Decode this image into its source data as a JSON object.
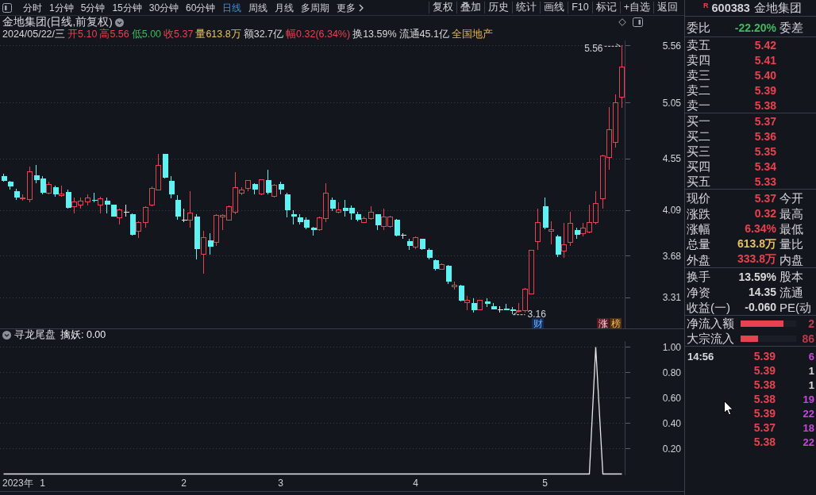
{
  "toolbar": {
    "periods": [
      {
        "label": "分时",
        "selected": false
      },
      {
        "label": "1分钟",
        "selected": false
      },
      {
        "label": "5分钟",
        "selected": false
      },
      {
        "label": "15分钟",
        "selected": false
      },
      {
        "label": "30分钟",
        "selected": false
      },
      {
        "label": "60分钟",
        "selected": false
      },
      {
        "label": "日线",
        "selected": true
      },
      {
        "label": "周线",
        "selected": false
      },
      {
        "label": "月线",
        "selected": false
      },
      {
        "label": "多周期",
        "selected": false
      }
    ],
    "more": "更多",
    "actions": [
      "复权",
      "叠加",
      "历史",
      "统计",
      "画线",
      "F10",
      "标记",
      "+自选",
      "返回"
    ]
  },
  "chart_header": {
    "title": "金地集团(日线,前复权)"
  },
  "quote_line": {
    "date": "2024/05/22/三",
    "items": [
      {
        "text": "开5.10",
        "color": "#e8414f"
      },
      {
        "text": "高5.56",
        "color": "#e8414f"
      },
      {
        "text": "低5.00",
        "color": "#3cb95c"
      },
      {
        "text": "收5.37",
        "color": "#e8414f"
      },
      {
        "text": "量613.8万",
        "color": "#e8c060"
      },
      {
        "text": "额32.7亿",
        "color": "#d8d8d8"
      },
      {
        "text": "幅0.32(6.34%)",
        "color": "#e8414f"
      },
      {
        "text": "换13.59%",
        "color": "#d8d8d8"
      },
      {
        "text": "流通45.1亿",
        "color": "#d8d8d8"
      },
      {
        "text": "全国地产",
        "color": "#e8b84a"
      }
    ]
  },
  "main_chart": {
    "chart_data": [
      {
        "type": "candlestick",
        "ohlc": [
          [
            4.39,
            4.41,
            4.34,
            4.35
          ],
          [
            4.34,
            4.35,
            4.27,
            4.3
          ],
          [
            4.26,
            4.28,
            4.18,
            4.2
          ],
          [
            4.19,
            4.23,
            4.17,
            4.2
          ],
          [
            4.18,
            4.48,
            4.16,
            4.43
          ],
          [
            4.4,
            4.49,
            4.33,
            4.36
          ],
          [
            4.37,
            4.39,
            4.23,
            4.24
          ],
          [
            4.24,
            4.34,
            4.23,
            4.32
          ],
          [
            4.29,
            4.31,
            4.21,
            4.23
          ],
          [
            4.22,
            4.31,
            4.21,
            4.23
          ],
          [
            4.25,
            4.27,
            4.1,
            4.11
          ],
          [
            4.12,
            4.2,
            4.06,
            4.16
          ],
          [
            4.13,
            4.2,
            4.1,
            4.17
          ],
          [
            4.16,
            4.23,
            4.13,
            4.2
          ],
          [
            4.18,
            4.24,
            4.16,
            4.17
          ],
          [
            4.13,
            4.21,
            4.06,
            4.19
          ],
          [
            4.17,
            4.2,
            4.06,
            4.14
          ],
          [
            4.14,
            4.14,
            4.03,
            4.03
          ],
          [
            4.02,
            4.1,
            3.96,
            4.09
          ],
          [
            4.07,
            4.14,
            4.03,
            4.07
          ],
          [
            4.05,
            4.06,
            3.86,
            3.87
          ],
          [
            3.9,
            3.99,
            3.84,
            3.98
          ],
          [
            3.98,
            4.12,
            3.93,
            4.11
          ],
          [
            4.13,
            4.3,
            4.12,
            4.28
          ],
          [
            4.27,
            4.59,
            4.27,
            4.49
          ],
          [
            4.59,
            4.59,
            4.37,
            4.38
          ],
          [
            4.35,
            4.39,
            4.19,
            4.23
          ],
          [
            4.18,
            4.22,
            4.0,
            4.03
          ],
          [
            4.0,
            4.1,
            3.98,
            4.0
          ],
          [
            4.0,
            4.26,
            3.93,
            4.06
          ],
          [
            4.03,
            4.05,
            3.65,
            3.74
          ],
          [
            3.69,
            3.9,
            3.52,
            3.84
          ],
          [
            3.82,
            3.88,
            3.69,
            3.76
          ],
          [
            3.8,
            4.05,
            3.77,
            4.04
          ],
          [
            4.03,
            4.05,
            3.91,
            4.04
          ],
          [
            4.0,
            4.13,
            4.0,
            4.12
          ],
          [
            4.07,
            4.43,
            4.05,
            4.29
          ],
          [
            4.24,
            4.29,
            4.22,
            4.27
          ],
          [
            4.28,
            4.36,
            4.26,
            4.35
          ],
          [
            4.32,
            4.33,
            4.23,
            4.27
          ],
          [
            4.23,
            4.36,
            4.22,
            4.36
          ],
          [
            4.36,
            4.45,
            4.23,
            4.24
          ],
          [
            4.21,
            4.32,
            4.2,
            4.31
          ],
          [
            4.32,
            4.34,
            4.23,
            4.27
          ],
          [
            4.23,
            4.24,
            4.02,
            4.09
          ],
          [
            4.05,
            4.09,
            3.96,
            4.03
          ],
          [
            4.02,
            4.05,
            3.96,
            3.98
          ],
          [
            4.0,
            4.02,
            3.92,
            3.93
          ],
          [
            3.93,
            3.94,
            3.86,
            3.91
          ],
          [
            3.91,
            4.03,
            3.9,
            4.02
          ],
          [
            4.01,
            4.33,
            3.98,
            4.24
          ],
          [
            4.18,
            4.2,
            4.08,
            4.1
          ],
          [
            4.07,
            4.16,
            4.06,
            4.09
          ],
          [
            4.11,
            4.18,
            4.03,
            4.08
          ],
          [
            4.11,
            4.13,
            4.0,
            4.06
          ],
          [
            4.05,
            4.07,
            3.99,
            4.0
          ],
          [
            3.98,
            4.03,
            3.97,
            4.01
          ],
          [
            4.01,
            4.12,
            4.0,
            4.07
          ],
          [
            4.05,
            4.05,
            3.91,
            3.95
          ],
          [
            3.94,
            4.1,
            3.91,
            4.03
          ],
          [
            3.94,
            4.04,
            3.93,
            4.03
          ],
          [
            4.0,
            4.01,
            3.85,
            3.86
          ],
          [
            3.86,
            3.88,
            3.83,
            3.86
          ],
          [
            3.81,
            3.83,
            3.73,
            3.77
          ],
          [
            3.76,
            3.85,
            3.74,
            3.84
          ],
          [
            3.83,
            3.83,
            3.73,
            3.74
          ],
          [
            3.73,
            3.75,
            3.65,
            3.66
          ],
          [
            3.64,
            3.65,
            3.55,
            3.56
          ],
          [
            3.56,
            3.61,
            3.56,
            3.6
          ],
          [
            3.59,
            3.6,
            3.43,
            3.45
          ],
          [
            3.4,
            3.45,
            3.38,
            3.42
          ],
          [
            3.41,
            3.42,
            3.27,
            3.28
          ],
          [
            3.26,
            3.32,
            3.19,
            3.28
          ],
          [
            3.26,
            3.3,
            3.17,
            3.19
          ],
          [
            3.2,
            3.28,
            3.2,
            3.28
          ],
          [
            3.27,
            3.3,
            3.22,
            3.25
          ],
          [
            3.23,
            3.26,
            3.2,
            3.2
          ],
          [
            3.2,
            3.23,
            3.17,
            3.2
          ],
          [
            3.21,
            3.25,
            3.19,
            3.19
          ],
          [
            3.2,
            3.22,
            3.16,
            3.19
          ],
          [
            3.18,
            3.26,
            3.17,
            3.19
          ],
          [
            3.19,
            3.39,
            3.17,
            3.38
          ],
          [
            3.34,
            3.73,
            3.34,
            3.73
          ],
          [
            3.81,
            4.1,
            3.73,
            3.98
          ],
          [
            4.12,
            4.2,
            3.92,
            3.93
          ],
          [
            3.9,
            3.99,
            3.78,
            3.91
          ],
          [
            3.85,
            3.87,
            3.67,
            3.69
          ],
          [
            3.72,
            3.97,
            3.66,
            3.78
          ],
          [
            3.8,
            4.07,
            3.77,
            3.97
          ],
          [
            3.91,
            3.93,
            3.83,
            3.87
          ],
          [
            3.88,
            3.97,
            3.85,
            3.93
          ],
          [
            3.89,
            4.14,
            3.88,
            3.98
          ],
          [
            3.98,
            4.26,
            3.96,
            4.15
          ],
          [
            4.19,
            4.58,
            4.1,
            4.57
          ],
          [
            4.56,
            5.01,
            4.45,
            4.81
          ],
          [
            4.69,
            5.12,
            4.65,
            5.05
          ],
          [
            5.1,
            5.56,
            5.0,
            5.37
          ]
        ],
        "ylim": [
          3.03,
          5.605
        ],
        "yticks": [
          3.31,
          3.68,
          4.09,
          4.55,
          5.05,
          5.56
        ],
        "grid": true,
        "annotations": [
          "5.56",
          "3.16"
        ]
      }
    ],
    "event_flags": [
      {
        "label": "财",
        "kind": "finance"
      },
      {
        "label": "涨",
        "kind": "rise"
      },
      {
        "label": "榜",
        "kind": "ranking"
      }
    ]
  },
  "indicator": {
    "name": "寻龙尾盘",
    "reading": "擒妖: 0.00",
    "chart_data": [
      {
        "type": "line",
        "xlabel": "2023年",
        "categories": [
          null,
          null,
          null,
          null,
          null,
          null,
          "1",
          null,
          null,
          null,
          null,
          null,
          null,
          null,
          null,
          null,
          null,
          null,
          null,
          null,
          null,
          null,
          null,
          null,
          null,
          null,
          null,
          null,
          "2",
          null,
          null,
          null,
          null,
          null,
          null,
          null,
          null,
          null,
          null,
          null,
          null,
          null,
          null,
          "3",
          null,
          null,
          null,
          null,
          null,
          null,
          null,
          null,
          null,
          null,
          null,
          null,
          null,
          null,
          null,
          null,
          null,
          null,
          null,
          null,
          "4",
          null,
          null,
          null,
          null,
          null,
          null,
          null,
          null,
          null,
          null,
          null,
          null,
          null,
          null,
          null,
          null,
          null,
          null,
          null,
          "5",
          null,
          null,
          null,
          null,
          null,
          null,
          null,
          null,
          null,
          null,
          null,
          null
        ],
        "values": [
          0,
          0,
          0,
          0,
          0,
          0,
          0,
          0,
          0,
          0,
          0,
          0,
          0,
          0,
          0,
          0,
          0,
          0,
          0,
          0,
          0,
          0,
          0,
          0,
          0,
          0,
          0,
          0,
          0,
          0,
          0,
          0,
          0,
          0,
          0,
          0,
          0,
          0,
          0,
          0,
          0,
          0,
          0,
          0,
          0,
          0,
          0,
          0,
          0,
          0,
          0,
          0,
          0,
          0,
          0,
          0,
          0,
          0,
          0,
          0,
          0,
          0,
          0,
          0,
          0,
          0,
          0,
          0,
          0,
          0,
          0,
          0,
          0,
          0,
          0,
          0,
          0,
          0,
          0,
          0,
          0,
          0,
          0,
          0,
          0,
          0,
          0,
          0,
          0,
          0,
          0,
          0,
          1,
          0,
          0,
          0,
          0
        ],
        "color": "#e6e6e6",
        "ylim": [
          0,
          1.035
        ],
        "yticks": [
          {
            "value": 0.2,
            "label": "0.20"
          },
          {
            "value": 0.4,
            "label": "0.40"
          },
          {
            "value": 0.6,
            "label": "0.60"
          },
          {
            "value": 0.8,
            "label": "0.80"
          },
          {
            "value": 1.0,
            "label": "1.00"
          }
        ],
        "grid": true
      }
    ]
  },
  "quote_panel": {
    "market_flag": "R",
    "code": "600383",
    "name": "金地集团",
    "sections": [
      [
        {
          "label": "委比",
          "value": "-22.20%",
          "color": "#3cb95c",
          "label_2": "委差"
        }
      ],
      [
        {
          "label": "卖五",
          "value": "5.42",
          "color": "#e8414f"
        },
        {
          "label": "卖四",
          "value": "5.41",
          "color": "#e8414f"
        },
        {
          "label": "卖三",
          "value": "5.40",
          "color": "#e8414f"
        },
        {
          "label": "卖二",
          "value": "5.39",
          "color": "#e8414f"
        },
        {
          "label": "卖一",
          "value": "5.38",
          "color": "#e8414f"
        }
      ],
      [
        {
          "label": "买一",
          "value": "5.37",
          "color": "#e8414f"
        },
        {
          "label": "买二",
          "value": "5.36",
          "color": "#e8414f"
        },
        {
          "label": "买三",
          "value": "5.35",
          "color": "#e8414f"
        },
        {
          "label": "买四",
          "value": "5.34",
          "color": "#e8414f"
        },
        {
          "label": "买五",
          "value": "5.33",
          "color": "#e8414f"
        }
      ],
      [
        {
          "label": "现价",
          "value": "5.37",
          "color": "#e8414f",
          "label_2": "今开"
        },
        {
          "label": "涨跌",
          "value": "0.32",
          "color": "#e8414f",
          "label_2": "最高"
        },
        {
          "label": "涨幅",
          "value": "6.34%",
          "color": "#e8414f",
          "label_2": "最低"
        },
        {
          "label": "总量",
          "value": "613.8万",
          "color": "#e8c060",
          "label_2": "量比"
        },
        {
          "label": "外盘",
          "value": "333.8万",
          "color": "#e8414f",
          "label_2": "内盘"
        }
      ],
      [
        {
          "label": "换手",
          "value": "13.59%",
          "color": "#d8d8d8",
          "label_2": "股本"
        },
        {
          "label": "净资",
          "value": "14.35",
          "color": "#d8d8d8",
          "label_2": "流通"
        },
        {
          "label": "收益(一)",
          "value": "-0.060",
          "color": "#d8d8d8",
          "label_2": "PE(动"
        }
      ]
    ],
    "flows": [
      {
        "label": "净流入额",
        "level": 0.77,
        "value": "2"
      },
      {
        "label": "大宗流入",
        "level": 0.31,
        "value": "86"
      }
    ],
    "ticks": [
      {
        "time": "14:56",
        "price": "5.39",
        "volume": "6",
        "color": "#c848d8"
      },
      {
        "price": "5.39",
        "volume": "1",
        "color": "#d8d8d8"
      },
      {
        "price": "5.38",
        "volume": "1",
        "color": "#d8d8d8"
      },
      {
        "price": "5.38",
        "volume": "19",
        "color": "#c848d8"
      },
      {
        "price": "5.39",
        "volume": "22",
        "color": "#c848d8"
      },
      {
        "price": "5.37",
        "volume": "18",
        "color": "#c848d8"
      },
      {
        "price": "5.38",
        "volume": "22",
        "color": "#c848d8"
      }
    ]
  }
}
